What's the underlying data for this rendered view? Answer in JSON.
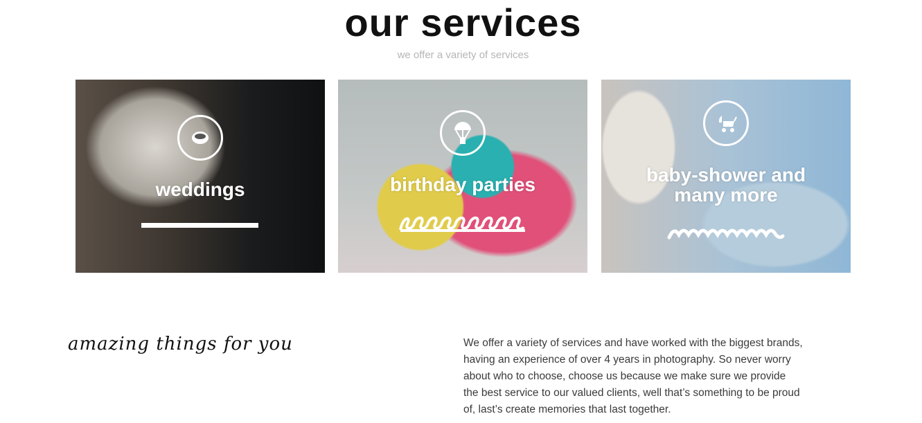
{
  "header": {
    "title": "our services",
    "subtitle": "we offer a variety of services"
  },
  "services": [
    {
      "title": "weddings",
      "icon": "ring-icon"
    },
    {
      "title": "birthday parties",
      "icon": "parachute-icon"
    },
    {
      "title_line1": "baby-shower and",
      "title_line2": "many more",
      "icon": "baby-carriage-icon"
    }
  ],
  "about": {
    "tagline": "amazing things for you",
    "lines": [
      "We offer a variety of services and have worked with the biggest brands,",
      "having an experience of over 4 years in photography. So never worry",
      "about who to choose, choose us because we make sure we provide",
      "the best service to our valued clients, well that’s something to be proud",
      "of, last’s create memories that last together."
    ]
  }
}
